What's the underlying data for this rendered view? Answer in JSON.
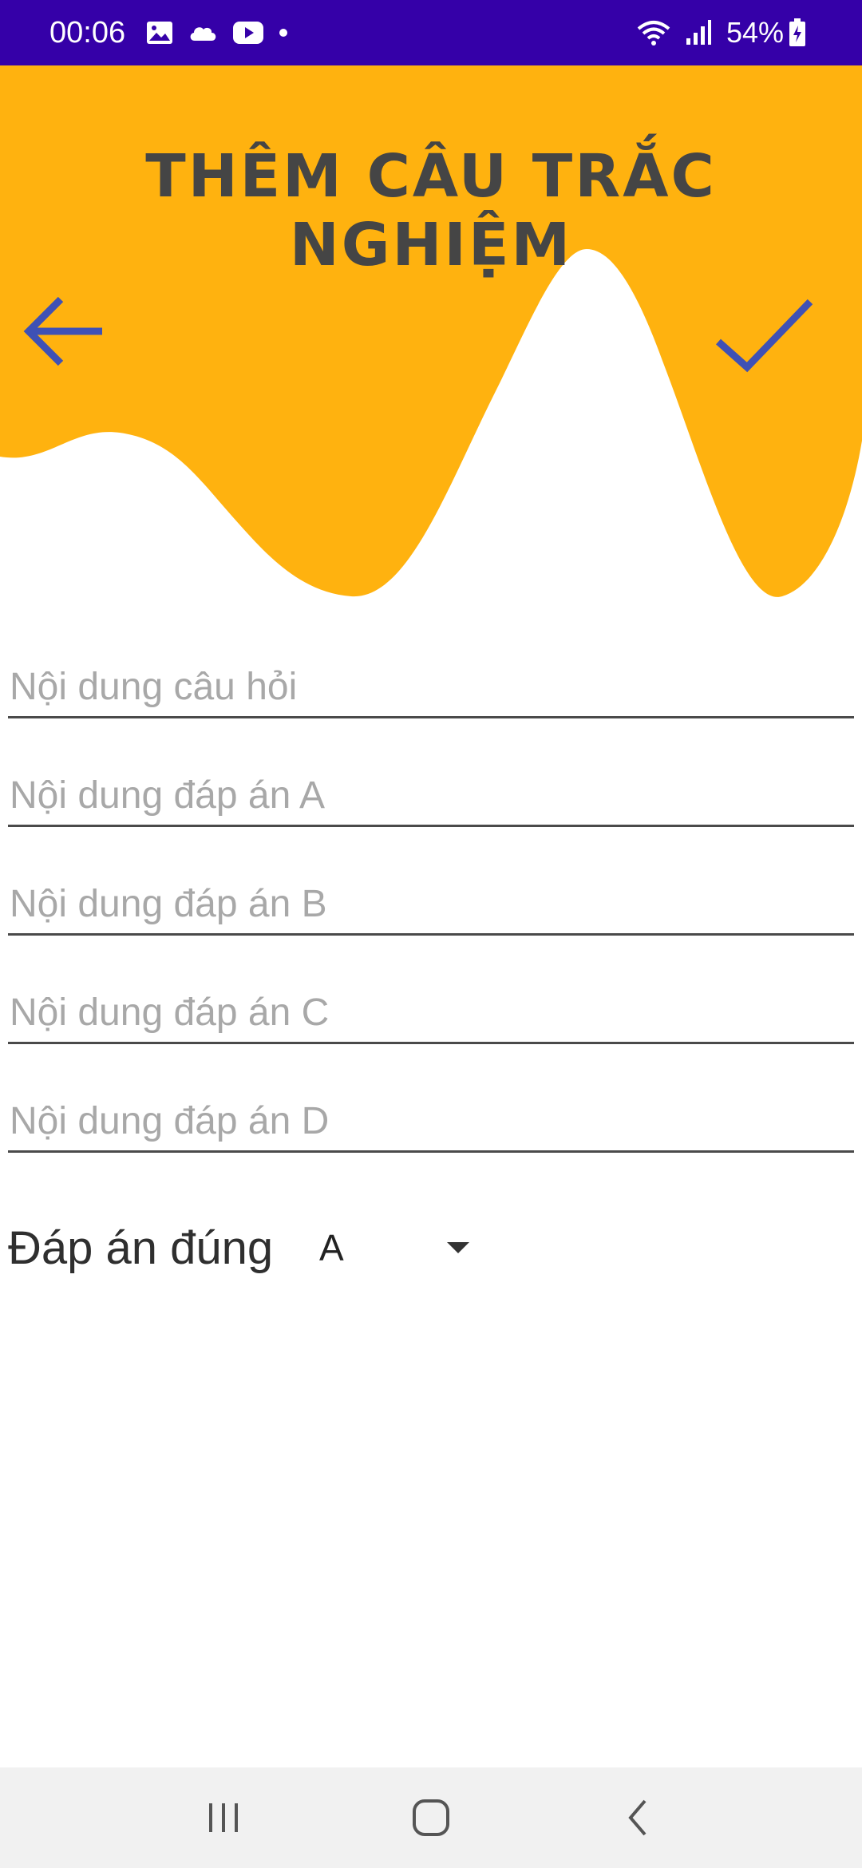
{
  "status_bar": {
    "time": "00:06",
    "battery": "54%",
    "left_icons": [
      "gallery-icon",
      "cloud-icon",
      "youtube-icon",
      "dot-icon"
    ],
    "right_icons": [
      "wifi-icon",
      "signal-icon",
      "battery-charging-icon"
    ]
  },
  "header": {
    "title": "THÊM CÂU TRẮC NGHIỆM",
    "back_icon": "arrow-left-icon",
    "confirm_icon": "checkmark-icon"
  },
  "form": {
    "question_placeholder": "Nội dung câu hỏi",
    "answer_a_placeholder": "Nội dung đáp án A",
    "answer_b_placeholder": "Nội dung đáp án B",
    "answer_c_placeholder": "Nội dung đáp án C",
    "answer_d_placeholder": "Nội dung đáp án D",
    "correct_answer_label": "Đáp án đúng",
    "correct_answer_value": "A"
  },
  "nav_bar": {
    "icons": [
      "recent-apps-icon",
      "home-icon",
      "back-icon"
    ]
  },
  "colors": {
    "status_bar": "#3500a8",
    "header_wave": "#ffb20f",
    "accent_icon": "#3f51b5",
    "title": "#454545"
  }
}
